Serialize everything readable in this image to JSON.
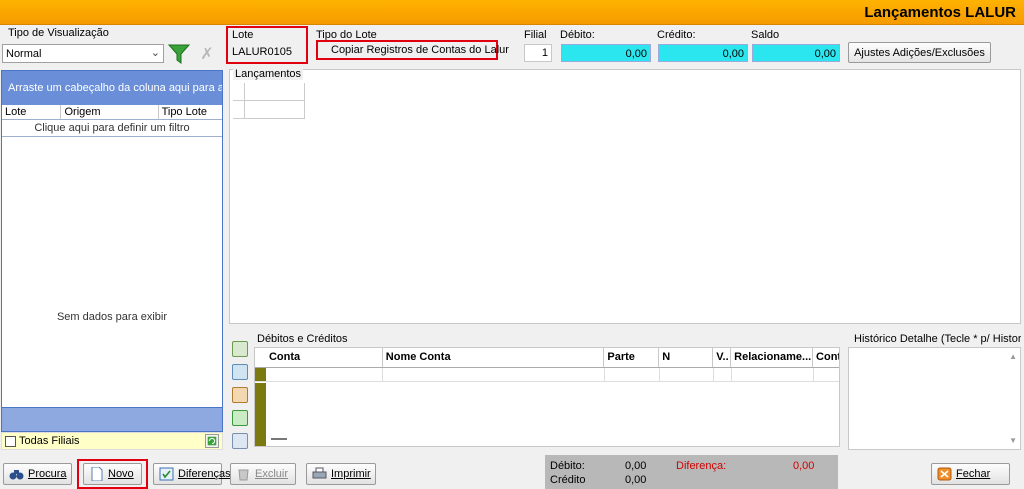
{
  "window": {
    "title": "Lançamentos LALUR"
  },
  "left": {
    "view_label": "Tipo de Visualização",
    "view_value": "Normal",
    "group_hint": "Arraste um cabeçalho da coluna aqui para agrupar",
    "columns": [
      "Lote",
      "Origem",
      "Tipo Lote"
    ],
    "filter_hint": "Clique aqui para definir um filtro",
    "empty": "Sem dados para exibir",
    "all_branches": "Todas Filiais"
  },
  "header": {
    "lote_label": "Lote",
    "lote_value": "LALUR0105",
    "tipo_label": "Tipo do Lote",
    "tipo_value": "Copiar Registros de Contas do Lalur",
    "filial_label": "Filial",
    "filial_value": "1",
    "debito_label": "Débito:",
    "debito_value": "0,00",
    "credito_label": "Crédito:",
    "credito_value": "0,00",
    "saldo_label": "Saldo",
    "saldo_value": "0,00",
    "ajustes_button": "Ajustes Adições/Exclusões"
  },
  "lancamentos": {
    "label": "Lançamentos"
  },
  "debcred": {
    "label": "Débitos e Créditos",
    "columns": [
      "Conta",
      "Nome Conta",
      "Parte",
      "N",
      "V..",
      "Relacioname...",
      "Conta"
    ]
  },
  "historico": {
    "label": "Histórico Detalhe (Tecle * p/ Historico"
  },
  "buttons": {
    "procura": "Procura",
    "novo": "Novo",
    "diferencas": "Diferenças",
    "excluir": "Excluir",
    "imprimir": "Imprimir",
    "fechar": "Fechar"
  },
  "totals": {
    "debito_label": "Débito:",
    "debito_value": "0,00",
    "credito_label": "Crédito",
    "credito_value": "0,00",
    "diferenca_label": "Diferença:",
    "diferenca_value": "0,00"
  },
  "colors": {
    "titlebar": "#f59a00",
    "highlight": "#e00010",
    "cyan": "#2ce6ef",
    "grid_blue": "#6a8fd8"
  },
  "icons": [
    "filter-icon",
    "clear-filter-icon",
    "refresh-icon",
    "binoculars-icon",
    "new-document-icon",
    "compare-icon",
    "delete-icon",
    "printer-icon",
    "close-icon"
  ]
}
